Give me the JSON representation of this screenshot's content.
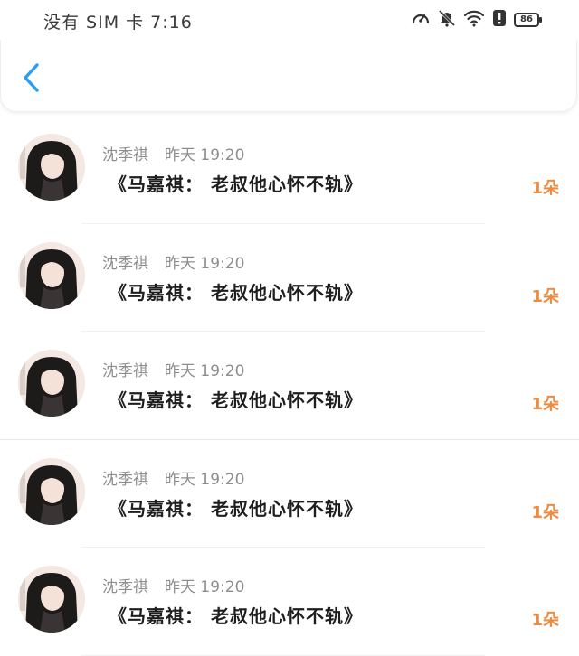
{
  "status_bar": {
    "carrier_time": "没有 SIM 卡 7:16",
    "battery": "86",
    "icons": [
      "speedometer-icon",
      "bell-off-icon",
      "wifi-icon",
      "alert-icon",
      "battery-icon"
    ]
  },
  "nav": {
    "back_icon": "chevron-left-icon",
    "accent_color": "#2a9df4"
  },
  "items": [
    {
      "author": "沈季祺",
      "time": "昨天 19:20",
      "title": "《马嘉祺： 老叔他心怀不轨》",
      "gift": "1朵"
    },
    {
      "author": "沈季祺",
      "time": "昨天 19:20",
      "title": "《马嘉祺： 老叔他心怀不轨》",
      "gift": "1朵"
    },
    {
      "author": "沈季祺",
      "time": "昨天 19:20",
      "title": "《马嘉祺： 老叔他心怀不轨》",
      "gift": "1朵"
    },
    {
      "author": "沈季祺",
      "time": "昨天 19:20",
      "title": "《马嘉祺： 老叔他心怀不轨》",
      "gift": "1朵"
    },
    {
      "author": "沈季祺",
      "time": "昨天 19:20",
      "title": "《马嘉祺： 老叔他心怀不轨》",
      "gift": "1朵"
    }
  ],
  "gift_color": "#f08a3e"
}
